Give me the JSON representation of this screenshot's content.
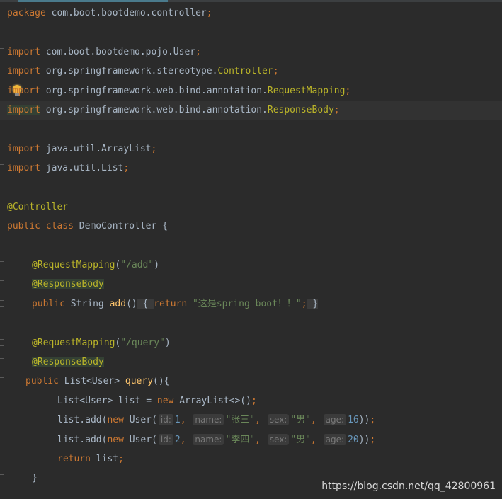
{
  "editor": {
    "colors": {
      "background": "#2b2b2b",
      "keyword": "#cc7832",
      "text": "#a9b7c6",
      "annotation": "#bbb529",
      "string": "#6a8759",
      "number": "#6897bb",
      "method": "#ffc66d"
    },
    "lines": [
      {
        "indent": 0,
        "tokens": [
          [
            "package",
            "kw"
          ],
          [
            " com.boot.bootdemo.controller",
            "tx"
          ],
          [
            ";",
            "se"
          ]
        ]
      },
      {
        "indent": 0,
        "tokens": []
      },
      {
        "indent": 0,
        "fold": true,
        "tokens": [
          [
            "import",
            "kw"
          ],
          [
            " com.boot.bootdemo.pojo.User",
            "tx"
          ],
          [
            ";",
            "se"
          ]
        ]
      },
      {
        "indent": 0,
        "tokens": [
          [
            "import",
            "kw"
          ],
          [
            " org.springframework.stereotype.",
            "tx"
          ],
          [
            "Controller",
            "an"
          ],
          [
            ";",
            "se"
          ]
        ]
      },
      {
        "indent": 0,
        "bulb": true,
        "tokens": [
          [
            "import",
            "kw"
          ],
          [
            " org.springframework.web.bind.annotation.",
            "tx"
          ],
          [
            "RequestMapping",
            "an"
          ],
          [
            ";",
            "se"
          ]
        ]
      },
      {
        "indent": 0,
        "current": true,
        "tokens": [
          [
            "import",
            "kw hl"
          ],
          [
            " org.springframework.web.bind.annotation.",
            "tx"
          ],
          [
            "ResponseBody",
            "an"
          ],
          [
            ";",
            "se"
          ]
        ]
      },
      {
        "indent": 0,
        "tokens": []
      },
      {
        "indent": 0,
        "tokens": [
          [
            "import",
            "kw"
          ],
          [
            " java.util.ArrayList",
            "tx"
          ],
          [
            ";",
            "se"
          ]
        ]
      },
      {
        "indent": 0,
        "fold": true,
        "tokens": [
          [
            "import",
            "kw"
          ],
          [
            " java.util.List",
            "tx"
          ],
          [
            ";",
            "se"
          ]
        ]
      },
      {
        "indent": 0,
        "tokens": []
      },
      {
        "indent": 0,
        "tokens": [
          [
            "@Controller",
            "an"
          ]
        ]
      },
      {
        "indent": 0,
        "tokens": [
          [
            "public class ",
            "kw"
          ],
          [
            "DemoController {",
            "tx"
          ]
        ]
      },
      {
        "indent": 0,
        "tokens": []
      },
      {
        "indent": 35,
        "fold": true,
        "tokens": [
          [
            "@RequestMapping",
            "an"
          ],
          [
            "(",
            "tx"
          ],
          [
            "\"/add\"",
            "st"
          ],
          [
            ")",
            "tx"
          ]
        ]
      },
      {
        "indent": 35,
        "fold": true,
        "tokens": [
          [
            "@ResponseBody",
            "an hl"
          ]
        ]
      },
      {
        "indent": 35,
        "fold": true,
        "tokens": [
          [
            "public ",
            "kw"
          ],
          [
            "String ",
            "tx"
          ],
          [
            "add",
            "me"
          ],
          [
            "()",
            "tx"
          ],
          [
            " { ",
            "tx fb"
          ],
          [
            "return ",
            "kw"
          ],
          [
            "\"这是spring boot！！\"",
            "st"
          ],
          [
            ";",
            "se"
          ],
          [
            " }",
            "tx fb"
          ]
        ]
      },
      {
        "indent": 0,
        "tokens": []
      },
      {
        "indent": 35,
        "fold": true,
        "tokens": [
          [
            "@RequestMapping",
            "an"
          ],
          [
            "(",
            "tx"
          ],
          [
            "\"/query\"",
            "st"
          ],
          [
            ")",
            "tx"
          ]
        ]
      },
      {
        "indent": 35,
        "fold": true,
        "tokens": [
          [
            "@ResponseBody",
            "an hl"
          ]
        ]
      },
      {
        "indent": 26,
        "fold": true,
        "tokens": [
          [
            "public ",
            "kw"
          ],
          [
            "List<User> ",
            "tx"
          ],
          [
            "query",
            "me"
          ],
          [
            "(){",
            "tx"
          ]
        ]
      },
      {
        "indent": 71,
        "tokens": [
          [
            "List<User> list = ",
            "tx"
          ],
          [
            "new ",
            "kw"
          ],
          [
            "ArrayList<>()",
            "tx"
          ],
          [
            ";",
            "se"
          ]
        ]
      },
      {
        "indent": 71,
        "tokens": [
          [
            "list.add(",
            "tx"
          ],
          [
            "new ",
            "kw"
          ],
          [
            "User(",
            "tx"
          ],
          [
            "id:",
            "hint"
          ],
          [
            "1",
            "nu"
          ],
          [
            ", ",
            "se"
          ],
          [
            "name:",
            "hint"
          ],
          [
            "\"张三\"",
            "st"
          ],
          [
            ", ",
            "se"
          ],
          [
            "sex:",
            "hint"
          ],
          [
            "\"男\"",
            "st"
          ],
          [
            ", ",
            "se"
          ],
          [
            "age:",
            "hint"
          ],
          [
            "16",
            "nu"
          ],
          [
            "))",
            "tx"
          ],
          [
            ";",
            "se"
          ]
        ]
      },
      {
        "indent": 71,
        "tokens": [
          [
            "list.add(",
            "tx"
          ],
          [
            "new ",
            "kw"
          ],
          [
            "User(",
            "tx"
          ],
          [
            "id:",
            "hint"
          ],
          [
            "2",
            "nu"
          ],
          [
            ", ",
            "se"
          ],
          [
            "name:",
            "hint"
          ],
          [
            "\"李四\"",
            "st"
          ],
          [
            ", ",
            "se"
          ],
          [
            "sex:",
            "hint"
          ],
          [
            "\"男\"",
            "st"
          ],
          [
            ", ",
            "se"
          ],
          [
            "age:",
            "hint"
          ],
          [
            "20",
            "nu"
          ],
          [
            "))",
            "tx"
          ],
          [
            ";",
            "se"
          ]
        ]
      },
      {
        "indent": 71,
        "tokens": [
          [
            "return ",
            "kw"
          ],
          [
            "list",
            "tx"
          ],
          [
            ";",
            "se"
          ]
        ]
      },
      {
        "indent": 35,
        "fold": true,
        "tokens": [
          [
            "}",
            "tx"
          ]
        ]
      }
    ]
  },
  "watermark": "https://blog.csdn.net/qq_42800961"
}
